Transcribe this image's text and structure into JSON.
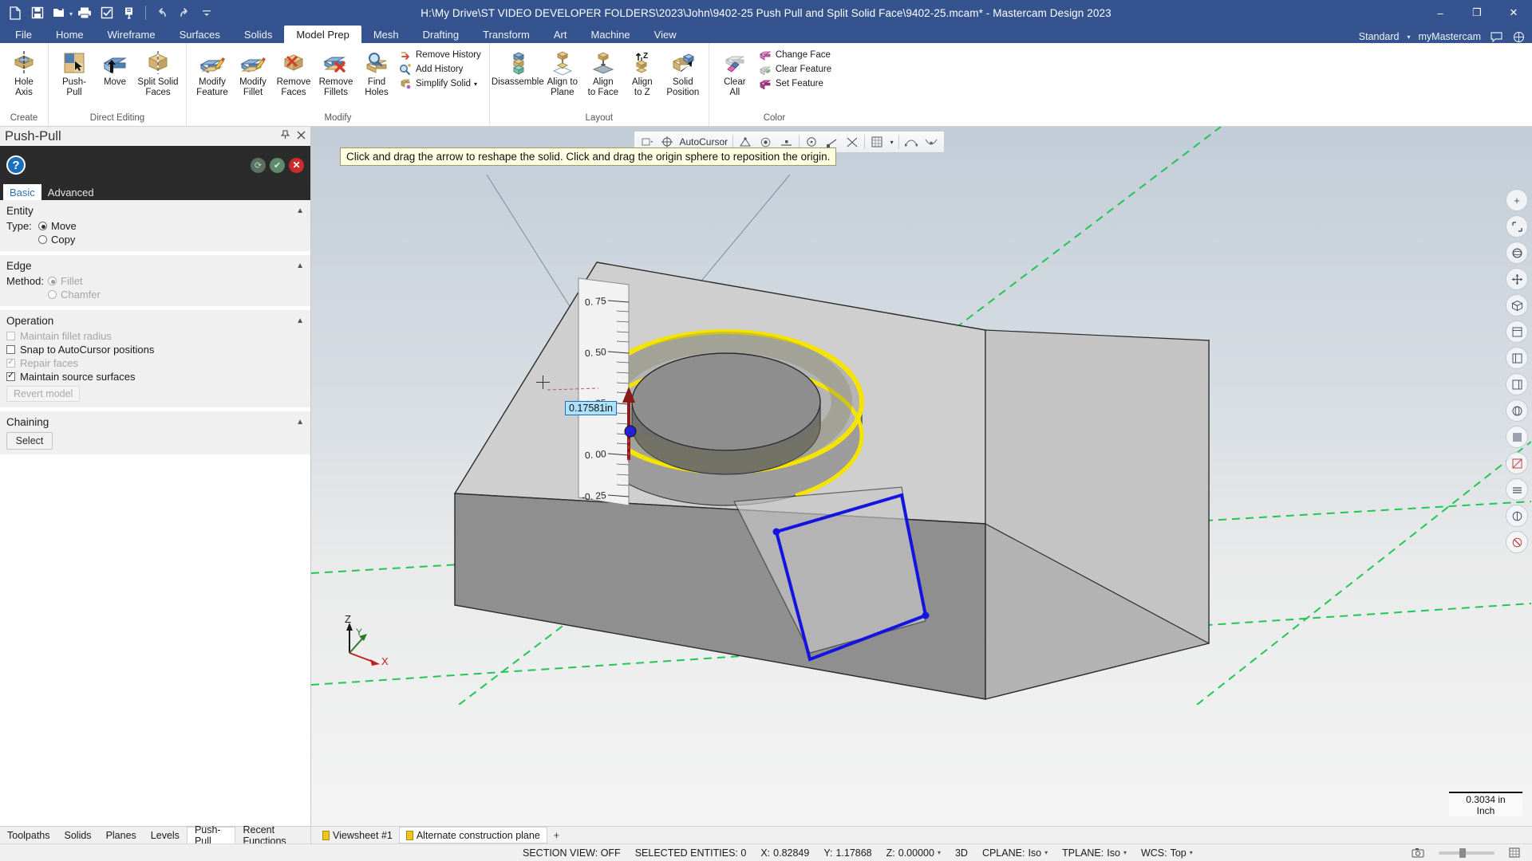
{
  "titlebar": {
    "title": "H:\\My Drive\\ST VIDEO DEVELOPER FOLDERS\\2023\\John\\9402-25 Push Pull and Split Solid Face\\9402-25.mcam* - Mastercam Design 2023",
    "quick_access": [
      {
        "name": "new-icon",
        "label": "New"
      },
      {
        "name": "save-icon",
        "label": "Save"
      },
      {
        "name": "open-icon",
        "label": "Open"
      },
      {
        "name": "print-icon",
        "label": "Print"
      },
      {
        "name": "print-preview-icon",
        "label": "Print Preview"
      },
      {
        "name": "zoom-window-icon",
        "label": "Zoom Window"
      },
      {
        "name": "undo-icon",
        "label": "Undo"
      },
      {
        "name": "redo-icon",
        "label": "Redo"
      },
      {
        "name": "customize-qat-icon",
        "label": "Customize Quick Access Toolbar"
      }
    ],
    "window_controls": {
      "minimize": "–",
      "maximize": "❐",
      "close": "✕"
    }
  },
  "ribbon": {
    "tabs": [
      {
        "label": "File",
        "active": false
      },
      {
        "label": "Home",
        "active": false
      },
      {
        "label": "Wireframe",
        "active": false
      },
      {
        "label": "Surfaces",
        "active": false
      },
      {
        "label": "Solids",
        "active": false
      },
      {
        "label": "Model Prep",
        "active": true
      },
      {
        "label": "Mesh",
        "active": false
      },
      {
        "label": "Drafting",
        "active": false
      },
      {
        "label": "Transform",
        "active": false
      },
      {
        "label": "Art",
        "active": false
      },
      {
        "label": "Machine",
        "active": false
      },
      {
        "label": "View",
        "active": false
      }
    ],
    "right": {
      "config": "Standard",
      "account": "myMastercam",
      "account_caret": "▾"
    },
    "groups": [
      {
        "title": "Create",
        "big_buttons": [
          {
            "label": "Hole\nAxis",
            "icon": "hole-axis-icon"
          }
        ],
        "small_buttons": []
      },
      {
        "title": "Direct Editing",
        "big_buttons": [
          {
            "label": "Push-Pull",
            "icon": "push-pull-icon"
          },
          {
            "label": "Move",
            "icon": "move-icon"
          },
          {
            "label": "Split Solid\nFaces",
            "icon": "split-solid-faces-icon"
          }
        ],
        "small_buttons": []
      },
      {
        "title": "Modify",
        "big_buttons": [
          {
            "label": "Modify\nFeature",
            "icon": "modify-feature-icon"
          },
          {
            "label": "Modify\nFillet",
            "icon": "modify-fillet-icon"
          },
          {
            "label": "Remove\nFaces",
            "icon": "remove-faces-icon"
          },
          {
            "label": "Remove\nFillets",
            "icon": "remove-fillets-icon"
          },
          {
            "label": "Find\nHoles",
            "icon": "find-holes-icon"
          }
        ],
        "small_buttons": [
          {
            "label": "Remove History",
            "icon": "remove-history-icon"
          },
          {
            "label": "Add History",
            "icon": "add-history-icon"
          },
          {
            "label": "Simplify Solid",
            "icon": "simplify-solid-icon",
            "caret": "▾"
          }
        ]
      },
      {
        "title": "Layout",
        "big_buttons": [
          {
            "label": "Disassemble",
            "icon": "disassemble-icon"
          },
          {
            "label": "Align to\nPlane",
            "icon": "align-to-plane-icon"
          },
          {
            "label": "Align\nto Face",
            "icon": "align-to-face-icon"
          },
          {
            "label": "Align\nto Z",
            "icon": "align-to-z-icon"
          },
          {
            "label": "Solid\nPosition",
            "icon": "solid-position-icon"
          }
        ],
        "small_buttons": []
      },
      {
        "title": "Color",
        "big_buttons": [
          {
            "label": "Clear\nAll",
            "icon": "clear-all-icon"
          }
        ],
        "small_buttons": [
          {
            "label": "Change Face",
            "icon": "change-face-icon"
          },
          {
            "label": "Clear Feature",
            "icon": "clear-feature-icon"
          },
          {
            "label": "Set Feature",
            "icon": "set-feature-icon"
          }
        ]
      }
    ]
  },
  "panel": {
    "title": "Push-Pull",
    "pin_icon": "pin-icon",
    "close_icon": "close-icon",
    "help_label": "?",
    "actions": [
      {
        "name": "apply-and-create-new-operation-button",
        "glyph": "⟳"
      },
      {
        "name": "ok-button",
        "glyph": "✔"
      },
      {
        "name": "cancel-button",
        "glyph": "✕"
      }
    ],
    "tabs": [
      {
        "label": "Basic",
        "active": true
      },
      {
        "label": "Advanced",
        "active": false
      }
    ],
    "sections": [
      {
        "title": "Entity",
        "collapse_icon": "▲",
        "lead_label": "Type:",
        "radios": [
          {
            "label": "Move",
            "selected": true,
            "disabled": false
          },
          {
            "label": "Copy",
            "selected": false,
            "disabled": false
          }
        ]
      },
      {
        "title": "Edge",
        "collapse_icon": "▲",
        "lead_label": "Method:",
        "radios": [
          {
            "label": "Fillet",
            "selected": true,
            "disabled": true
          },
          {
            "label": "Chamfer",
            "selected": false,
            "disabled": true
          }
        ]
      },
      {
        "title": "Operation",
        "collapse_icon": "▲",
        "checkboxes": [
          {
            "label": "Maintain fillet radius",
            "checked": false,
            "disabled": true
          },
          {
            "label": "Snap to AutoCursor positions",
            "checked": false,
            "disabled": false
          },
          {
            "label": "Repair faces",
            "checked": true,
            "disabled": true
          },
          {
            "label": "Maintain source surfaces",
            "checked": true,
            "disabled": false
          }
        ],
        "button": {
          "label": "Revert model",
          "disabled": true
        }
      },
      {
        "title": "Chaining",
        "collapse_icon": "▲",
        "button": {
          "label": "Select",
          "disabled": false
        }
      }
    ]
  },
  "viewport": {
    "autocursor": {
      "label": "AutoCursor",
      "left_caret": "▾",
      "icons": [
        "autocursor-target-icon",
        "autocursor-snap-icon",
        "autocursor-point-icon",
        "autocursor-midpoint-icon",
        "autocursor-center-icon",
        "autocursor-endpoint-icon",
        "autocursor-intersect-icon",
        "autocursor-grid-icon",
        "autocursor-dropdown-icon",
        "autocursor-relative-icon",
        "autocursor-nearest-icon"
      ]
    },
    "tooltip": "Click and drag the arrow to reshape the solid.  Click and drag the origin sphere to reposition the origin.",
    "dimension_value": "0.17581in",
    "ruler_ticks": [
      "0.75",
      "0.50",
      "0.25",
      "0.00",
      "-0.25"
    ],
    "scale": {
      "value": "0.3034 in",
      "unit": "Inch"
    },
    "axis_labels": {
      "x": "X",
      "y": "Y",
      "z": "Z"
    },
    "side_toolbar": [
      "fit-icon",
      "unzoom-icon",
      "dynamic-rotate-icon",
      "pan-icon",
      "isometric-view-icon",
      "top-view-icon",
      "front-view-icon",
      "right-view-icon",
      "wireframe-shading-icon",
      "shaded-icon",
      "section-view-icon",
      "levels-icon",
      "appearance-icon",
      "no-shade-icon"
    ]
  },
  "bottom": {
    "left_tabs": [
      {
        "label": "Toolpaths",
        "active": false
      },
      {
        "label": "Solids",
        "active": false
      },
      {
        "label": "Planes",
        "active": false
      },
      {
        "label": "Levels",
        "active": false
      },
      {
        "label": "Push-Pull",
        "active": true
      },
      {
        "label": "Recent Functions",
        "active": false
      }
    ],
    "sheets": [
      {
        "label": "Viewsheet #1",
        "active": false
      },
      {
        "label": "Alternate construction plane",
        "active": true
      }
    ],
    "add_sheet": "+"
  },
  "status": {
    "section_view": "SECTION VIEW: OFF",
    "selected_entities": "SELECTED ENTITIES: 0",
    "coords": [
      {
        "label": "X:",
        "value": "0.82849"
      },
      {
        "label": "Y:",
        "value": "1.17868"
      },
      {
        "label": "Z:",
        "value": "0.00000",
        "caret": "▾"
      }
    ],
    "mode_3d": "3D",
    "cplane": {
      "label": "CPLANE:",
      "value": "Iso",
      "caret": "▾"
    },
    "tplane": {
      "label": "TPLANE:",
      "value": "Iso",
      "caret": "▾"
    },
    "wcs": {
      "label": "WCS:",
      "value": "Top",
      "caret": "▾"
    }
  },
  "colors": {
    "brand_blue": "#35548f",
    "accent_blue": "#1c6fba",
    "selection_yellow": "#f5e400",
    "selection_blue": "#1414e0",
    "arrow_red": "#8b1a1a",
    "cancel_red": "#cc2b2b"
  }
}
